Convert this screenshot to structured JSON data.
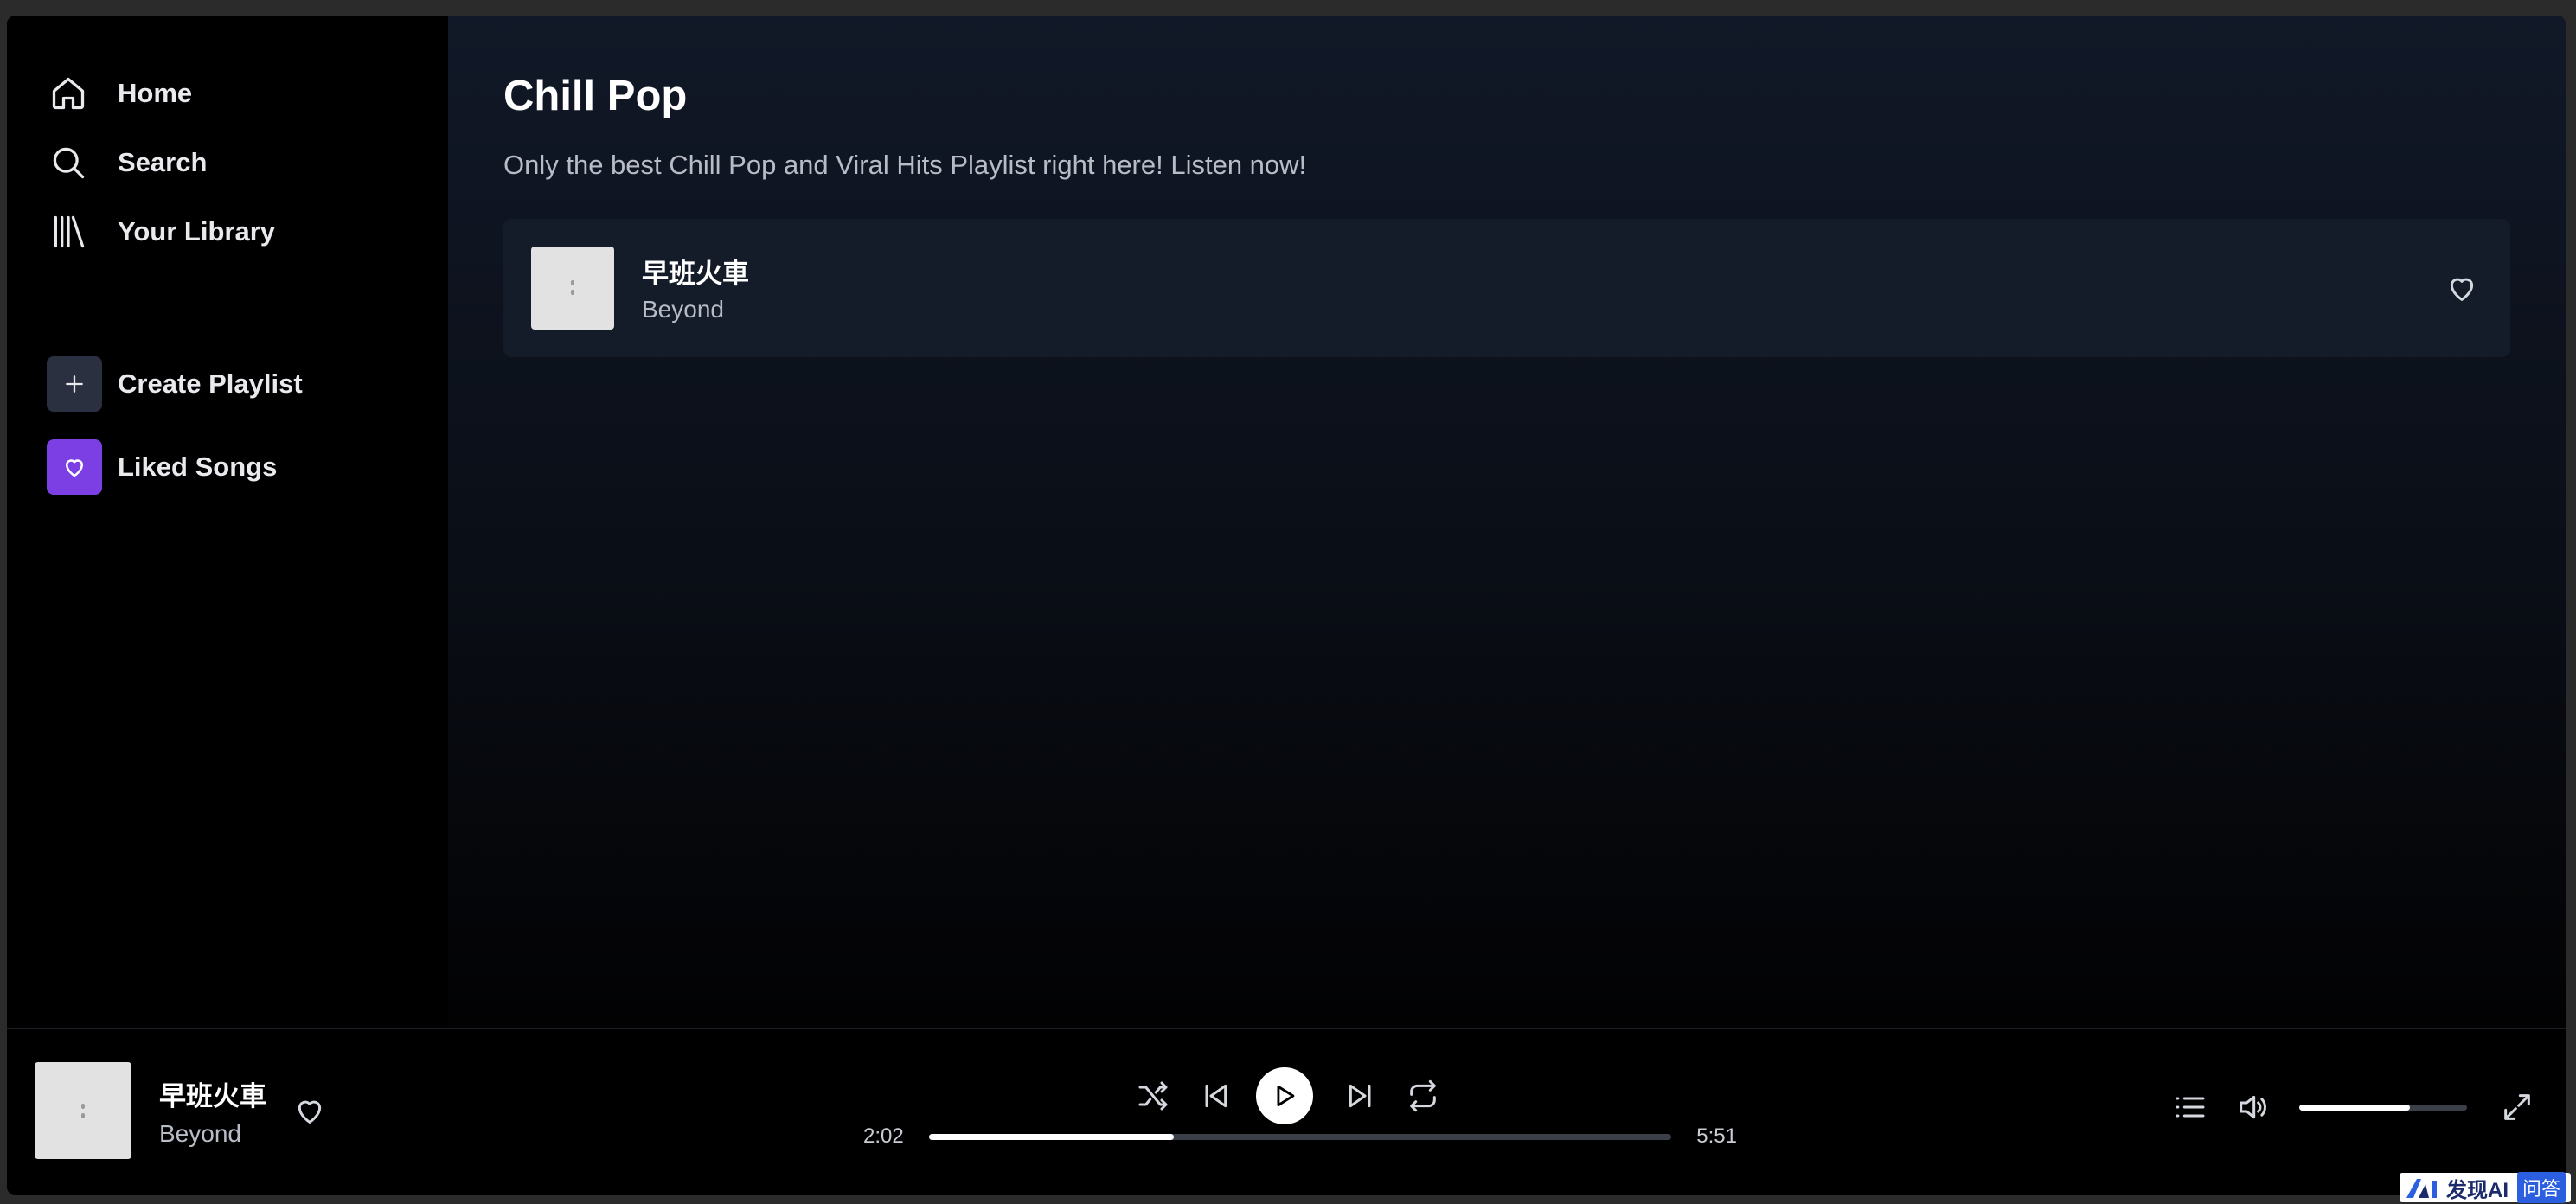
{
  "sidebar": {
    "nav": [
      {
        "label": "Home",
        "icon": "home-icon"
      },
      {
        "label": "Search",
        "icon": "search-icon"
      },
      {
        "label": "Your Library",
        "icon": "library-icon"
      }
    ],
    "actions": [
      {
        "label": "Create Playlist",
        "icon": "plus-icon"
      },
      {
        "label": "Liked Songs",
        "icon": "heart-icon",
        "color": "#7b3fe4"
      }
    ]
  },
  "playlist": {
    "title": "Chill Pop",
    "description": "Only the best Chill Pop and Viral Hits Playlist right here! Listen now!",
    "tracks": [
      {
        "title": "早班火車",
        "artist": "Beyond",
        "liked": false
      }
    ]
  },
  "player": {
    "now_playing": {
      "title": "早班火車",
      "artist": "Beyond"
    },
    "elapsed": "2:02",
    "duration": "5:51",
    "progress_fraction": 0.33,
    "volume_fraction": 0.66,
    "controls": [
      "shuffle-icon",
      "previous-icon",
      "play-icon",
      "next-icon",
      "repeat-icon"
    ],
    "right_controls": [
      "queue-icon",
      "volume-icon",
      "fullscreen-icon"
    ]
  },
  "watermark": {
    "text": "发现AI",
    "badge": "问答"
  },
  "colors": {
    "accent": "#7b3fe4",
    "background_top": "#111827",
    "row": "#151c29"
  }
}
